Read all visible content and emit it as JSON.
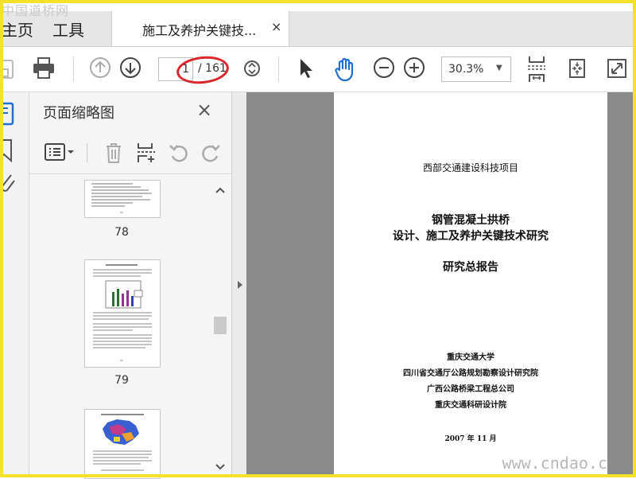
{
  "watermark": {
    "top_text": "中国道桥网",
    "bottom_text": "www.cndao.c"
  },
  "tabbar": {
    "nav_home": "主页",
    "nav_tools": "工具",
    "active_tab_title": "施工及养护关键技...",
    "tab_close": "×"
  },
  "toolbar": {
    "current_page": "1",
    "total_pages": "/ 161",
    "zoom": "30.3%",
    "zoom_caret": "▼",
    "icons": [
      "save-icon",
      "print-icon",
      "previous-page-icon",
      "next-page-icon",
      "page-stepper-icon",
      "select-cursor-icon",
      "hand-tool-icon",
      "zoom-out-icon",
      "zoom-in-icon",
      "scroll-mode-icon",
      "fit-page-icon",
      "full-screen-icon"
    ]
  },
  "left_rail": {
    "icons": [
      "page-thumbnails-icon",
      "bookmarks-icon",
      "attachments-icon"
    ]
  },
  "thumbnail_panel": {
    "title": "页面缩略图",
    "close": "×",
    "tools": [
      "thumbnail-options-icon",
      "delete-page-icon",
      "insert-page-icon",
      "rotate-counterclockwise-icon",
      "rotate-clockwise-icon"
    ],
    "pages": [
      {
        "number": "78"
      },
      {
        "number": "79"
      }
    ]
  },
  "document": {
    "project": "西部交通建设科技项目",
    "title_line1": "钢管混凝土拱桥",
    "title_line2": "设计、施工及养护关键技术研究",
    "report_type": "研究总报告",
    "orgs": [
      "重庆交通大学",
      "四川省交通厅公路规划勘察设计研究院",
      "广西公路桥梁工程总公司",
      "重庆交通科研设计院"
    ],
    "date": "2007 年 11 月"
  },
  "colors": {
    "accent_red": "#d8262c",
    "frame_yellow": "#f2e22a",
    "viewer_bg": "#8a8a8a"
  }
}
